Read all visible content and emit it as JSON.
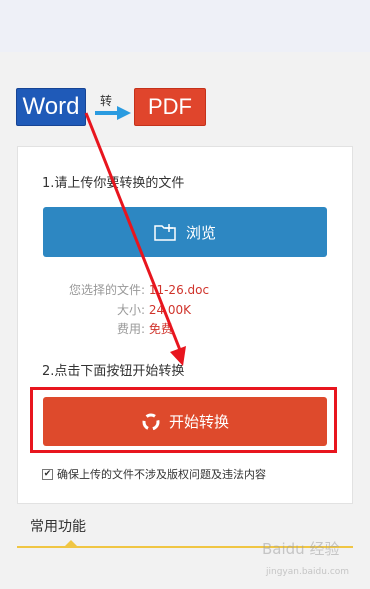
{
  "header": {
    "source_format": "Word",
    "convert_label": "转",
    "target_format": "PDF"
  },
  "upload": {
    "step1_text": "1.请上传你要转换的文件",
    "browse_label": "浏览"
  },
  "file_info": {
    "file_label": "您选择的文件:",
    "file_value": "11-26.doc",
    "size_label": "大小:",
    "size_value": "24.00K",
    "fee_label": "费用:",
    "fee_value": "免费"
  },
  "convert": {
    "step2_text": "2.点击下面按钮开始转换",
    "start_label": "开始转换"
  },
  "agreement": {
    "checked": true,
    "text": "确保上传的文件不涉及版权问题及违法内容"
  },
  "common": {
    "title": "常用功能"
  },
  "watermark": {
    "brand": "Baidu 经验",
    "url": "jingyan.baidu.com"
  },
  "colors": {
    "word_blue": "#1f5ab8",
    "pdf_red": "#e0452c",
    "browse_blue": "#2d87c2",
    "start_red": "#de4a2c",
    "highlight_red": "#e8151e"
  }
}
